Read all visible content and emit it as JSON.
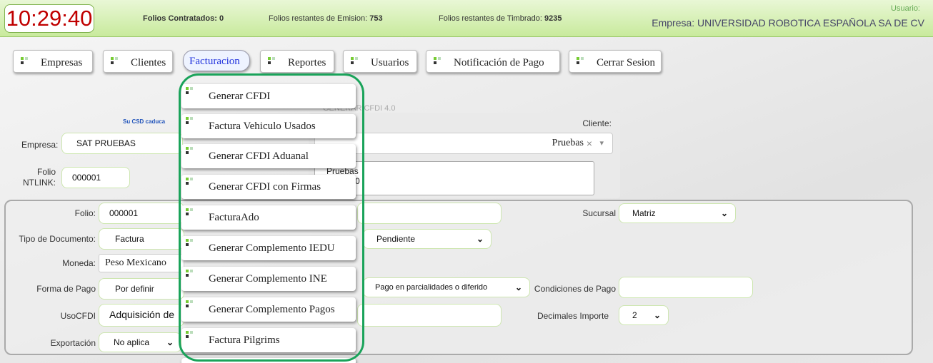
{
  "header": {
    "clock": "10:29:40",
    "folios_contratados_label": "Folios Contratados: 0",
    "folios_emision_label": "Folios restantes de Emision:",
    "folios_emision_value": "753",
    "folios_timbrado_label": "Folios restantes de Timbrado:",
    "folios_timbrado_value": "9235",
    "usuario_label": "Usuario:",
    "empresa_label": "Empresa: UNIVERSIDAD ROBOTICA ESPAÑOLA SA DE CV"
  },
  "nav": {
    "items": [
      "Empresas",
      "Clientes",
      "Facturacion",
      "Reportes",
      "Usuarios",
      "Notificación de Pago",
      "Cerrar Sesion"
    ]
  },
  "dropdown": {
    "items": [
      "Generar CFDI",
      "Factura Vehiculo Usados",
      "Generar CFDI Aduanal",
      "Generar CFDI con Firmas",
      "FacturaAdo",
      "Generar Complemento IEDU",
      "Generar Complemento INE",
      "Generar Complemento Pagos",
      "Factura Pilgrims"
    ]
  },
  "form": {
    "csd_notice": "Su CSD caduca",
    "generar_label": "GENERAR CFDI 4.0",
    "empresa_label": "Empresa:",
    "empresa_value": "SAT PRUEBAS",
    "folio_ntlink_label_1": "Folio",
    "folio_ntlink_label_2": "NTLINK:",
    "folio_ntlink_value": "000001",
    "cliente_label": "Cliente:",
    "cliente_value": "Pruebas",
    "cliente_clear": "×",
    "cliente_arrow": "▾",
    "cliente_detail_line1": "Pruebas",
    "cliente_detail_line2": "0101000",
    "folio_label": "Folio:",
    "folio_value": "000001",
    "sucursal_label": "Sucursal",
    "sucursal_value": "Matriz",
    "tipo_doc_label": "Tipo de Documento:",
    "tipo_doc_value": "Factura",
    "estado_value": "Pendiente",
    "moneda_label": "Moneda:",
    "moneda_value": "Peso Mexicano",
    "forma_pago_label": "Forma de Pago",
    "forma_pago_value": "Por definir",
    "metodo_pago_value": "Pago en parcialidades o diferido",
    "condiciones_label": "Condiciones de Pago",
    "usocfdi_label": "UsoCFDI",
    "usocfdi_value": "Adquisición de",
    "decimales_label": "Decimales Importe",
    "decimales_value": "2",
    "exportacion_label": "Exportación",
    "exportacion_value": "No aplica"
  }
}
